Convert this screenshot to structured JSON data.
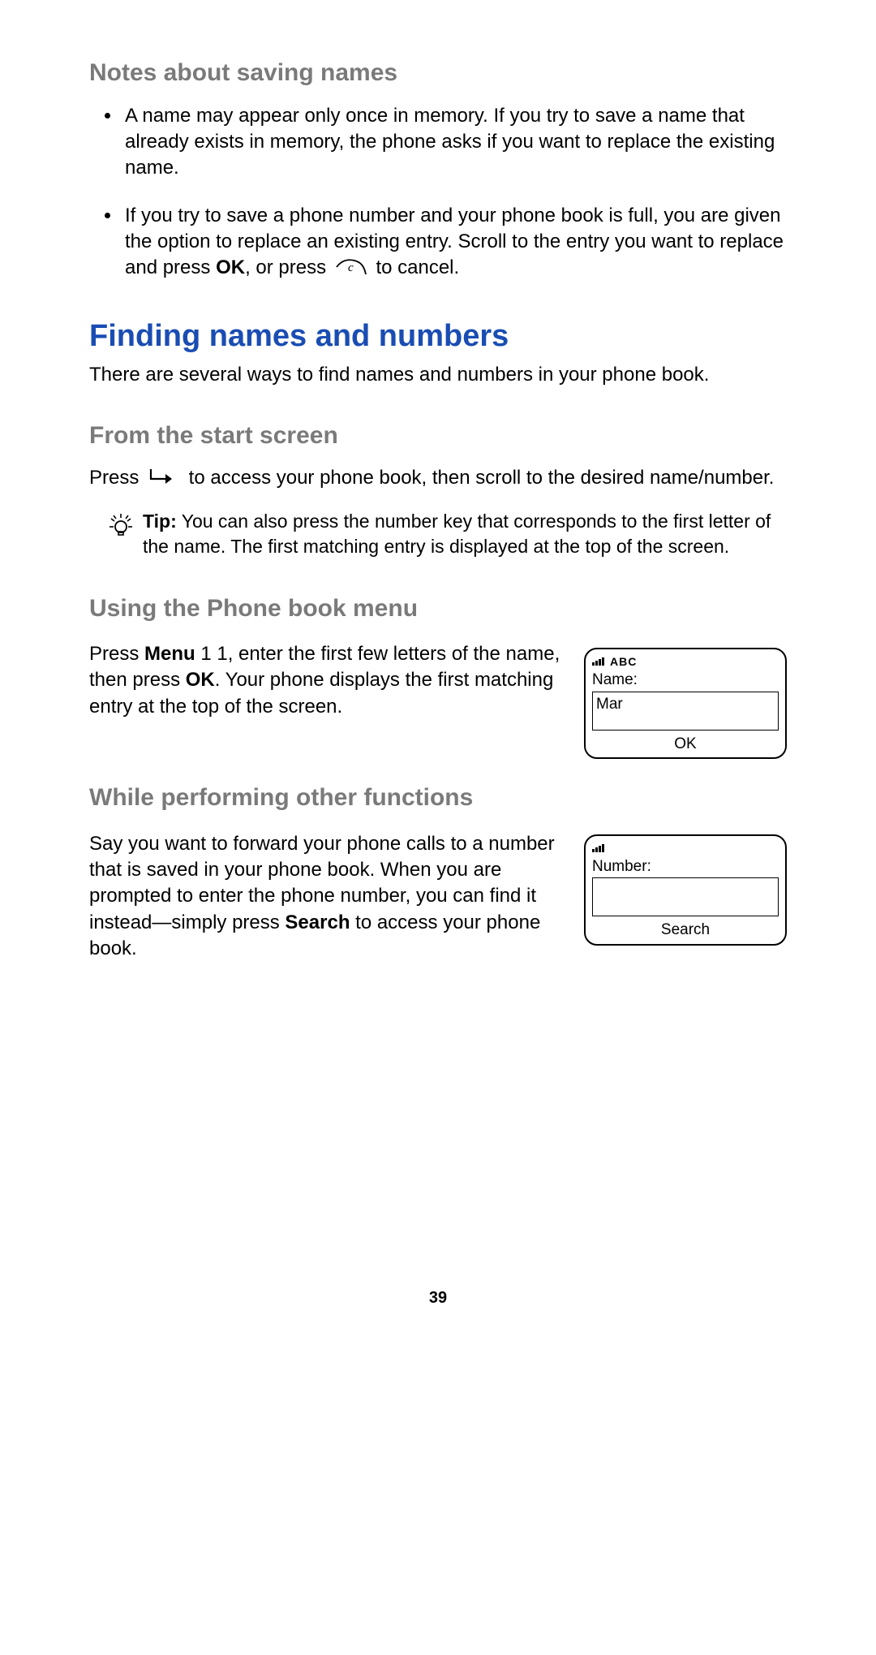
{
  "notes": {
    "heading": "Notes about saving names",
    "bullets": [
      {
        "text": "A name may appear only once in memory. If you try to save a name that already exists in memory, the phone asks if you want to replace the existing name."
      },
      {
        "prefix": "If you try to save a phone number and your phone book is full, you are given the option to replace an existing entry. Scroll to the entry you want to replace and press ",
        "ok": "OK",
        "middle": ", or press ",
        "suffix": " to cancel."
      }
    ]
  },
  "finding": {
    "heading": "Finding names and numbers",
    "intro": "There are several ways to find names and numbers in your phone book."
  },
  "from_start": {
    "heading": "From the start screen",
    "prefix": "Press ",
    "suffix": " to access your phone book, then scroll to the desired name/number."
  },
  "tip": {
    "label": "Tip:",
    "body": "  You can also press the number key that corresponds to the first letter of the name. The first matching entry is displayed at the top of the screen."
  },
  "using_menu": {
    "heading": "Using the Phone book menu",
    "p1": "Press ",
    "menu_bold": "Menu",
    "mid1": " 1 1, enter the first few letters of the name, then press ",
    "ok_bold": "OK",
    "mid2": ". Your phone displays the first matching entry at the top of the screen."
  },
  "other_functions": {
    "heading": "While performing other functions",
    "p1": "Say you want to forward your phone calls to a number that is saved in your phone book. When you are prompted to enter the phone number, you can find it instead—simply press ",
    "search_bold": "Search",
    "suffix": " to access your phone book."
  },
  "figures": {
    "name_entry": {
      "header_text": "ABC",
      "label": "Name:",
      "value": "Mar",
      "button": "OK"
    },
    "number_entry": {
      "label": "Number:",
      "value": "",
      "button": "Search"
    }
  },
  "page_number": "39"
}
